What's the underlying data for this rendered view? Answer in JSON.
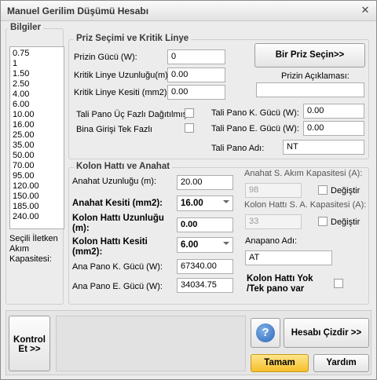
{
  "window": {
    "title": "Manuel Gerilim Düşümü Hesabı",
    "close_glyph": "✕"
  },
  "bilgiler": {
    "title": "Bilgiler",
    "capacities": [
      "0.75",
      "1",
      "1.50",
      "2.50",
      "4.00",
      "6.00",
      "10.00",
      "16.00",
      "25.00",
      "35.00",
      "50.00",
      "70.00",
      "95.00",
      "120.00",
      "150.00",
      "185.00",
      "240.00"
    ],
    "selected_caption": "Seçili İletken Akım Kapasitesi:"
  },
  "priz": {
    "title": "Priz Seçimi ve Kritik Linye",
    "priz_gucu_label": "Prizin Gücü (W):",
    "priz_gucu_value": "0",
    "kritik_uzunlugu_label": "Kritik Linye Uzunluğu(m):",
    "kritik_uzunlugu_value": "0.00",
    "kritik_kesiti_label": "Kritik Linye Kesiti (mm2):",
    "kritik_kesiti_value": "0.00",
    "bir_priz_button": "Bir Priz Seçin>>",
    "priz_aciklamasi_label": "Prizin Açıklaması:",
    "priz_aciklamasi_value": "",
    "tali_uc_fazli_label": "Tali Pano Üç Fazlı Dağıtılmış",
    "bina_tek_fazli_label": "Bina Girişi Tek Fazlı",
    "tali_k_gucu_label": "Tali  Pano K. Gücü (W):",
    "tali_k_gucu_value": "0.00",
    "tali_e_gucu_label": "Tali  Pano E. Gücü (W):",
    "tali_e_gucu_value": "0.00",
    "tali_pano_adi_label": "Tali Pano Adı:",
    "tali_pano_adi_value": "NT"
  },
  "kolon": {
    "title": "Kolon Hattı ve Anahat",
    "anahat_uzunlugu_label": "Anahat Uzunluğu (m):",
    "anahat_uzunlugu_value": "20.00",
    "anahat_kesiti_label": "Anahat Kesiti (mm2):",
    "anahat_kesiti_value": "16.00",
    "kolon_uzunlugu_label": "Kolon Hattı Uzunluğu (m):",
    "kolon_uzunlugu_value": "0.00",
    "kolon_kesiti_label": "Kolon Hattı Kesiti (mm2):",
    "kolon_kesiti_value": "6.00",
    "ana_k_gucu_label": "Ana Pano K. Gücü (W):",
    "ana_k_gucu_value": "67340.00",
    "ana_e_gucu_label": "Ana Pano E. Gücü (W):",
    "ana_e_gucu_value": "34034.75",
    "anahat_kapasite_label": "Anahat S. Akım Kapasitesi (A):",
    "anahat_kapasite_value": "98",
    "degistir_label": "Değiştir",
    "kolon_kapasite_label": "Kolon Hattı S. A. Kapasitesi (A):",
    "kolon_kapasite_value": "33",
    "anapano_adi_label": "Anapano Adı:",
    "anapano_adi_value": "AT",
    "kolon_yok_label": "Kolon Hattı Yok /Tek pano var"
  },
  "bottom": {
    "kontrol_button": "Kontrol Et >>",
    "help_glyph": "?",
    "hesabi_cizdir_button": "Hesabı Çizdir >>",
    "tamam_button": "Tamam",
    "yardim_button": "Yardım"
  }
}
